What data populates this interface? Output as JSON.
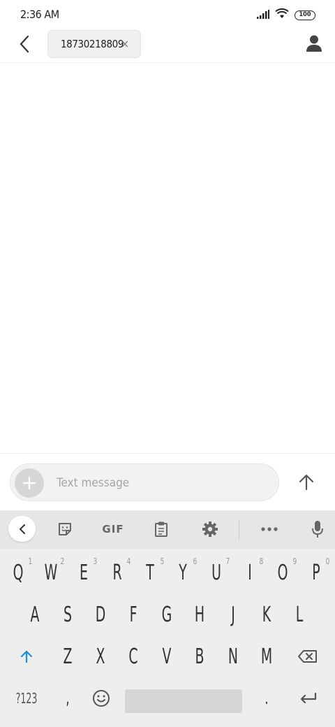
{
  "status_bar": {
    "time": "2:36 AM",
    "battery": "100",
    "signal_icon": "signal-bars-icon",
    "wifi_icon": "wifi-icon"
  },
  "header": {
    "back_icon": "chevron-left-icon",
    "recipient": "18730218809",
    "chip_close": "×",
    "contact_icon": "person-icon"
  },
  "compose": {
    "placeholder": "Text message",
    "attach_icon": "plus-icon",
    "send_icon": "arrow-up-icon"
  },
  "keyboard": {
    "toolbar": {
      "collapse_icon": "chevron-left-icon",
      "sticker_icon": "sticker-icon",
      "gif_label": "GIF",
      "clipboard_icon": "clipboard-icon",
      "settings_icon": "gear-icon",
      "more_icon": "more-dots-icon",
      "mic_icon": "microphone-icon"
    },
    "row1": [
      "Q",
      "W",
      "E",
      "R",
      "T",
      "Y",
      "U",
      "I",
      "O",
      "P"
    ],
    "row1_hints": [
      "1",
      "2",
      "3",
      "4",
      "5",
      "6",
      "7",
      "8",
      "9",
      "0"
    ],
    "row2": [
      "A",
      "S",
      "D",
      "F",
      "G",
      "H",
      "J",
      "K",
      "L"
    ],
    "row3": [
      "Z",
      "X",
      "C",
      "V",
      "B",
      "N",
      "M"
    ],
    "symbols_key": "?123",
    "comma_key": ",",
    "period_key": ".",
    "shift_icon": "shift-arrow-icon",
    "backspace_icon": "backspace-icon",
    "emoji_icon": "emoji-icon",
    "enter_icon": "enter-icon"
  },
  "colors": {
    "accent": "#1a8fe3",
    "keyboard_bg": "#eeeeee",
    "toolbar_bg": "#e6e6e6"
  }
}
